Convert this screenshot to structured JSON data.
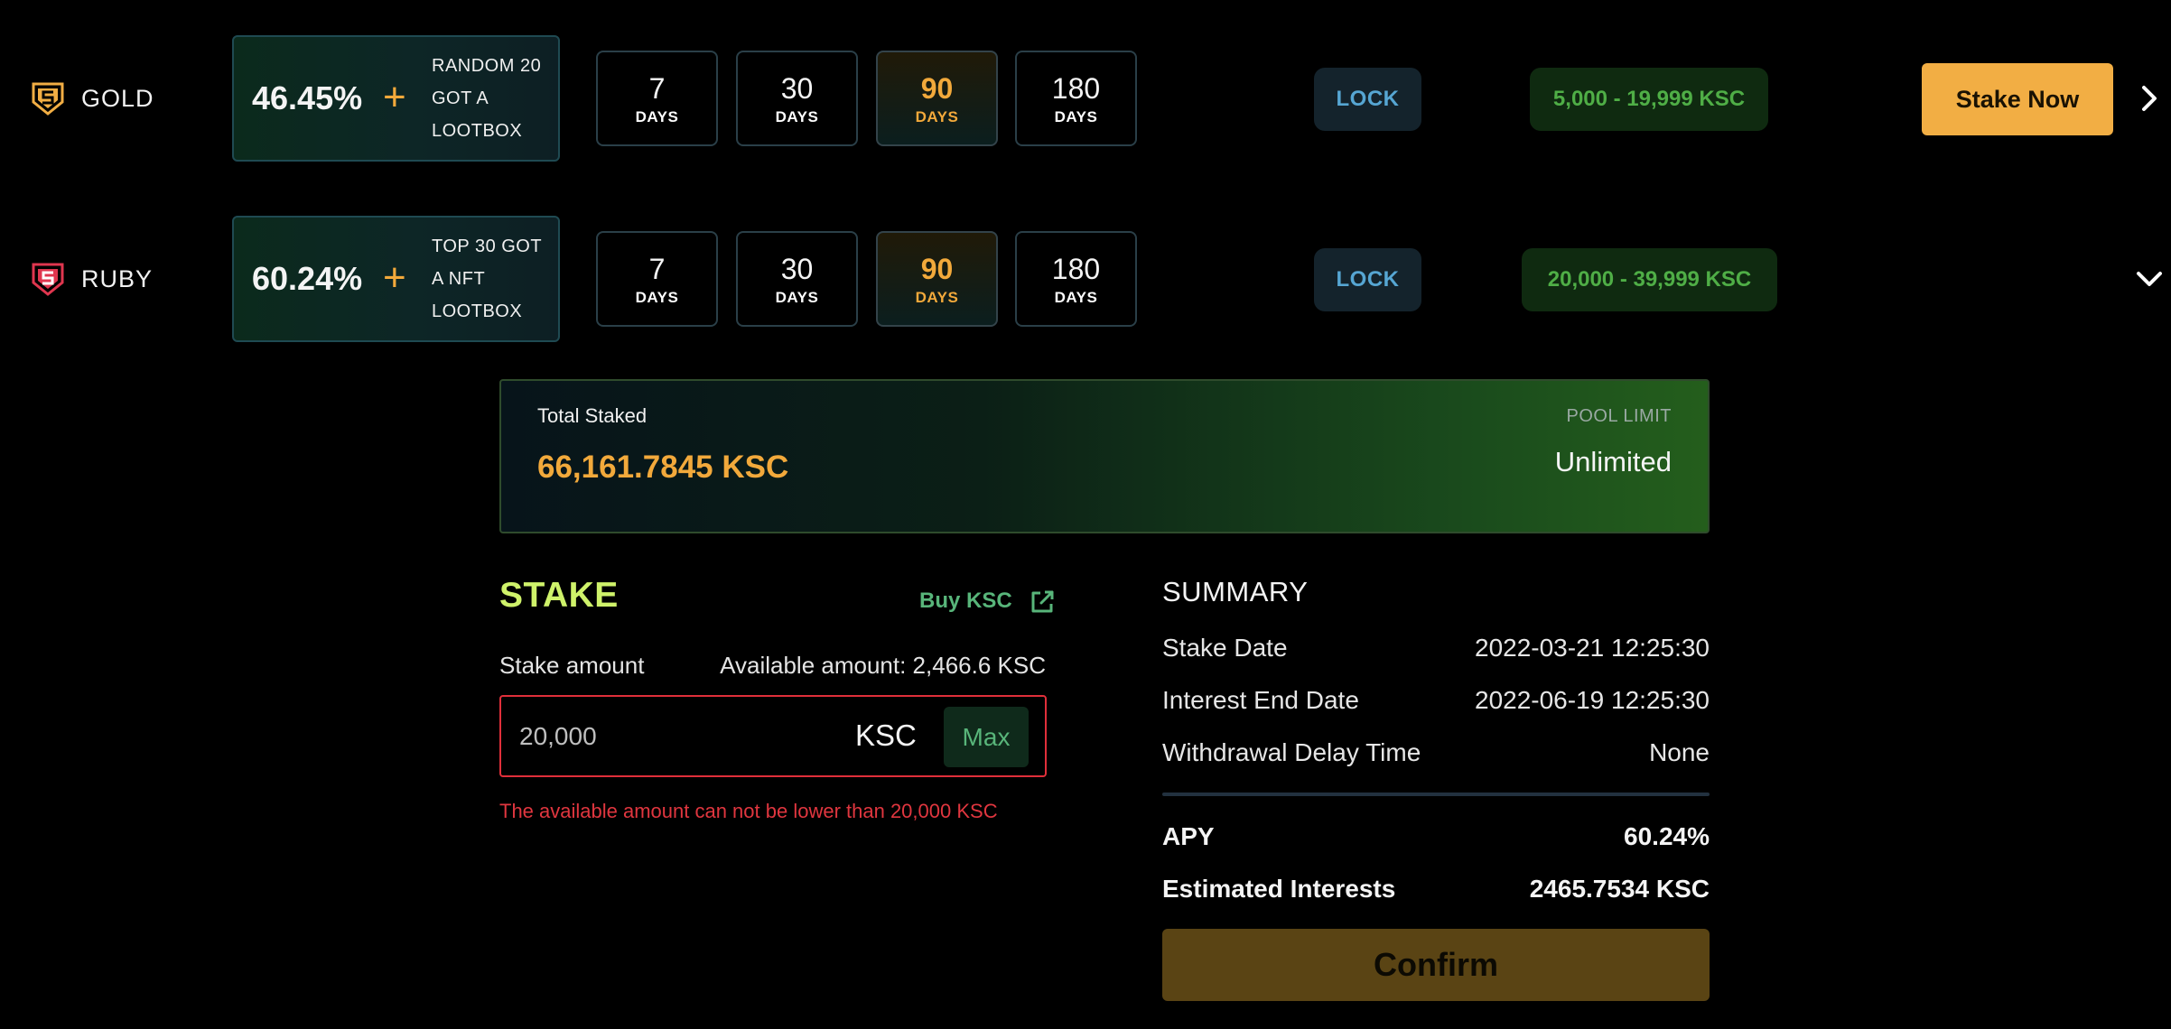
{
  "tiers": [
    {
      "name": "GOLD",
      "badge_icon": "shield-s-icon",
      "badge_color": "#f2ae44",
      "apy": "46.45%",
      "plus": "+",
      "reward_lines": [
        "RANDOM 20",
        "GOT A",
        "LOOTBOX"
      ],
      "durations": [
        {
          "num": "7",
          "label": "DAYS"
        },
        {
          "num": "30",
          "label": "DAYS"
        },
        {
          "num": "90",
          "label": "DAYS"
        },
        {
          "num": "180",
          "label": "DAYS"
        }
      ],
      "active_duration": "90",
      "lock_label": "LOCK",
      "range": "5,000 - 19,999 KSC",
      "stake_now_label": "Stake Now",
      "toggle_icon": "chevron-right-icon"
    },
    {
      "name": "RUBY",
      "badge_icon": "shield-s-icon",
      "badge_color": "#e0364f",
      "apy": "60.24%",
      "plus": "+",
      "reward_lines": [
        "TOP 30 GOT",
        "A NFT",
        "LOOTBOX"
      ],
      "durations": [
        {
          "num": "7",
          "label": "DAYS"
        },
        {
          "num": "30",
          "label": "DAYS"
        },
        {
          "num": "90",
          "label": "DAYS"
        },
        {
          "num": "180",
          "label": "DAYS"
        }
      ],
      "active_duration": "90",
      "lock_label": "LOCK",
      "range": "20,000 - 39,999 KSC",
      "toggle_icon": "chevron-down-icon"
    }
  ],
  "pool": {
    "total_label": "Total Staked",
    "total_value": "66,161.7845 KSC",
    "limit_label": "POOL LIMIT",
    "limit_value": "Unlimited"
  },
  "stake": {
    "title": "STAKE",
    "buy_label": "Buy KSC",
    "amount_label": "Stake amount",
    "available_label": "Available amount: 2,466.6 KSC",
    "amount_value": "20,000",
    "currency": "KSC",
    "max_label": "Max",
    "error": "The available amount can not be lower than 20,000 KSC"
  },
  "summary": {
    "title": "SUMMARY",
    "rows": [
      {
        "key": "Stake Date",
        "value": "2022-03-21 12:25:30"
      },
      {
        "key": "Interest End Date",
        "value": "2022-06-19 12:25:30"
      },
      {
        "key": "Withdrawal Delay Time",
        "value": "None"
      }
    ],
    "apy_label": "APY",
    "apy_value": "60.24%",
    "est_label": "Estimated Interests",
    "est_value": "2465.7534 KSC",
    "confirm_label": "Confirm"
  },
  "colors": {
    "accent_orange": "#f2ae44",
    "accent_green": "#58b57a",
    "error_red": "#e0363f",
    "stake_title": "#cff26a"
  }
}
